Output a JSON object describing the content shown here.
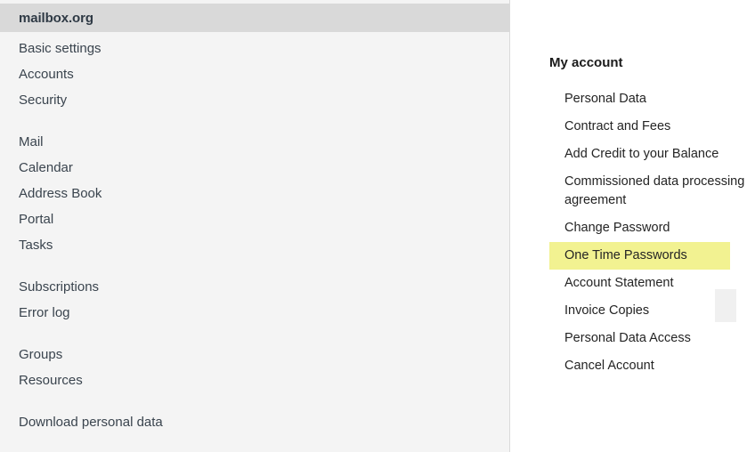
{
  "sidebar": {
    "brand": "mailbox.org",
    "groups": [
      {
        "items": [
          {
            "label": "Basic settings"
          },
          {
            "label": "Accounts"
          },
          {
            "label": "Security"
          }
        ]
      },
      {
        "items": [
          {
            "label": "Mail"
          },
          {
            "label": "Calendar"
          },
          {
            "label": "Address Book"
          },
          {
            "label": "Portal"
          },
          {
            "label": "Tasks"
          }
        ]
      },
      {
        "items": [
          {
            "label": "Subscriptions"
          },
          {
            "label": "Error log"
          }
        ]
      },
      {
        "items": [
          {
            "label": "Groups"
          },
          {
            "label": "Resources"
          }
        ]
      },
      {
        "items": [
          {
            "label": "Download personal data"
          }
        ]
      }
    ]
  },
  "account_panel": {
    "title": "My account",
    "highlight_color": "#f2f291",
    "items": [
      {
        "label": "Personal Data",
        "highlighted": false
      },
      {
        "label": "Contract and Fees",
        "highlighted": false
      },
      {
        "label": "Add Credit to your Balance",
        "highlighted": false
      },
      {
        "label": "Commissioned data processing agreement",
        "highlighted": false
      },
      {
        "label": "Change Password",
        "highlighted": false
      },
      {
        "label": "One Time Passwords",
        "highlighted": true
      },
      {
        "label": "Account Statement",
        "highlighted": false
      },
      {
        "label": "Invoice Copies",
        "highlighted": false
      },
      {
        "label": "Personal Data Access",
        "highlighted": false
      },
      {
        "label": "Cancel Account",
        "highlighted": false
      }
    ]
  }
}
